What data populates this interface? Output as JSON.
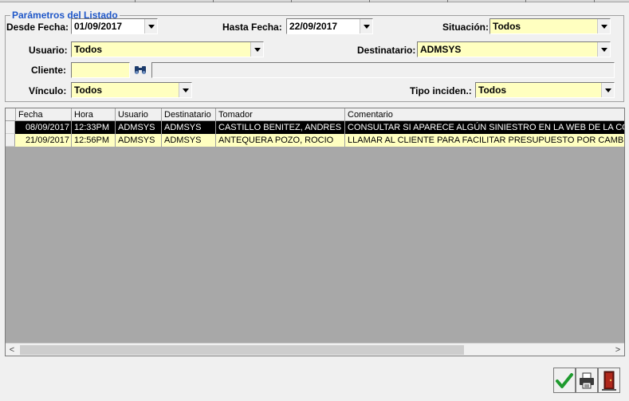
{
  "params": {
    "legend": "Parámetros del Listado",
    "desde_fecha_label": "Desde Fecha:",
    "desde_fecha_value": "01/09/2017",
    "hasta_fecha_label": "Hasta Fecha:",
    "hasta_fecha_value": "22/09/2017",
    "situacion_label": "Situación:",
    "situacion_value": "Todos",
    "usuario_label": "Usuario:",
    "usuario_value": "Todos",
    "destinatario_label": "Destinatario:",
    "destinatario_value": "ADMSYS",
    "cliente_label": "Cliente:",
    "cliente_value": "",
    "cliente_name": "",
    "vinculo_label": "Vínculo:",
    "vinculo_value": "Todos",
    "tipo_label": "Tipo inciden.:",
    "tipo_value": "Todos"
  },
  "grid": {
    "columns": [
      "Fecha",
      "Hora",
      "Usuario",
      "Destinatario",
      "Tomador",
      "Comentario"
    ],
    "rows": [
      {
        "fecha": "08/09/2017",
        "hora": "12:33PM",
        "usuario": "ADMSYS",
        "destinatario": "ADMSYS",
        "tomador": "CASTILLO BENITEZ, ANDRES",
        "comentario": "CONSULTAR SI APARECE ALGÚN SINIESTRO EN LA WEB DE LA COI",
        "selected": true
      },
      {
        "fecha": "21/09/2017",
        "hora": "12:56PM",
        "usuario": "ADMSYS",
        "destinatario": "ADMSYS",
        "tomador": "ANTEQUERA POZO, ROCIO",
        "comentario": "LLAMAR AL CLIENTE PARA FACILITAR PRESUPUESTO POR CAMBIO",
        "selected": false
      }
    ]
  },
  "colors": {
    "accent": "#1f57c8",
    "field_yellow": "#ffffc0",
    "selected_row": "#000000",
    "grid_background": "#a8a8a8"
  },
  "toolbar": {
    "icons": [
      "checkmark-icon",
      "printer-icon",
      "exit-door-icon"
    ]
  }
}
